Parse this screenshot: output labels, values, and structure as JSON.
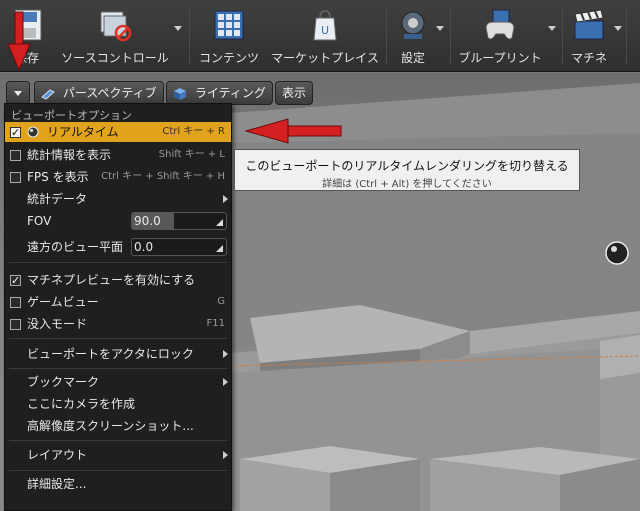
{
  "toolbar": {
    "items": [
      {
        "label": "保存"
      },
      {
        "label": "ソースコントロール"
      },
      {
        "label": "コンテンツ"
      },
      {
        "label": "マーケットプレイス"
      },
      {
        "label": "設定"
      },
      {
        "label": "ブループリント"
      },
      {
        "label": "マチネ"
      }
    ]
  },
  "viewport_bar": {
    "perspective_label": "パースペクティブ",
    "lighting_label": "ライティング",
    "show_label": "表示"
  },
  "menu": {
    "header": "ビューポートオプション",
    "realtime": {
      "label": "リアルタイム",
      "shortcut": "Ctrl キー + R",
      "checked": true
    },
    "stats": {
      "label": "統計情報を表示",
      "shortcut": "Shift キー + L",
      "checked": false
    },
    "fps": {
      "label": "FPS を表示",
      "shortcut": "Ctrl キー + Shift キー + H",
      "checked": false
    },
    "stat_data": {
      "label": "統計データ"
    },
    "fov": {
      "label": "FOV",
      "value": "90.0",
      "fill_fraction": 0.45
    },
    "far_plane": {
      "label": "遠方のビュー平面",
      "value": "0.0"
    },
    "matinee_preview": {
      "label": "マチネプレビューを有効にする",
      "checked": true
    },
    "game_view": {
      "label": "ゲームビュー",
      "shortcut": "G",
      "checked": false
    },
    "immersive": {
      "label": "没入モード",
      "shortcut": "F11",
      "checked": false
    },
    "lock_actor": {
      "label": "ビューポートをアクタにロック"
    },
    "bookmarks": {
      "label": "ブックマーク"
    },
    "create_camera": {
      "label": "ここにカメラを作成"
    },
    "hires_screenshot": {
      "label": "高解像度スクリーンショット..."
    },
    "layout": {
      "label": "レイアウト"
    },
    "advanced": {
      "label": "詳細設定..."
    }
  },
  "tooltip": {
    "title": "このビューポートのリアルタイムレンダリングを切り替える",
    "subtitle": "詳細は (Ctrl + Alt) を押してください"
  },
  "colors": {
    "highlight": "#e1a21c",
    "arrow": "#d42020"
  }
}
